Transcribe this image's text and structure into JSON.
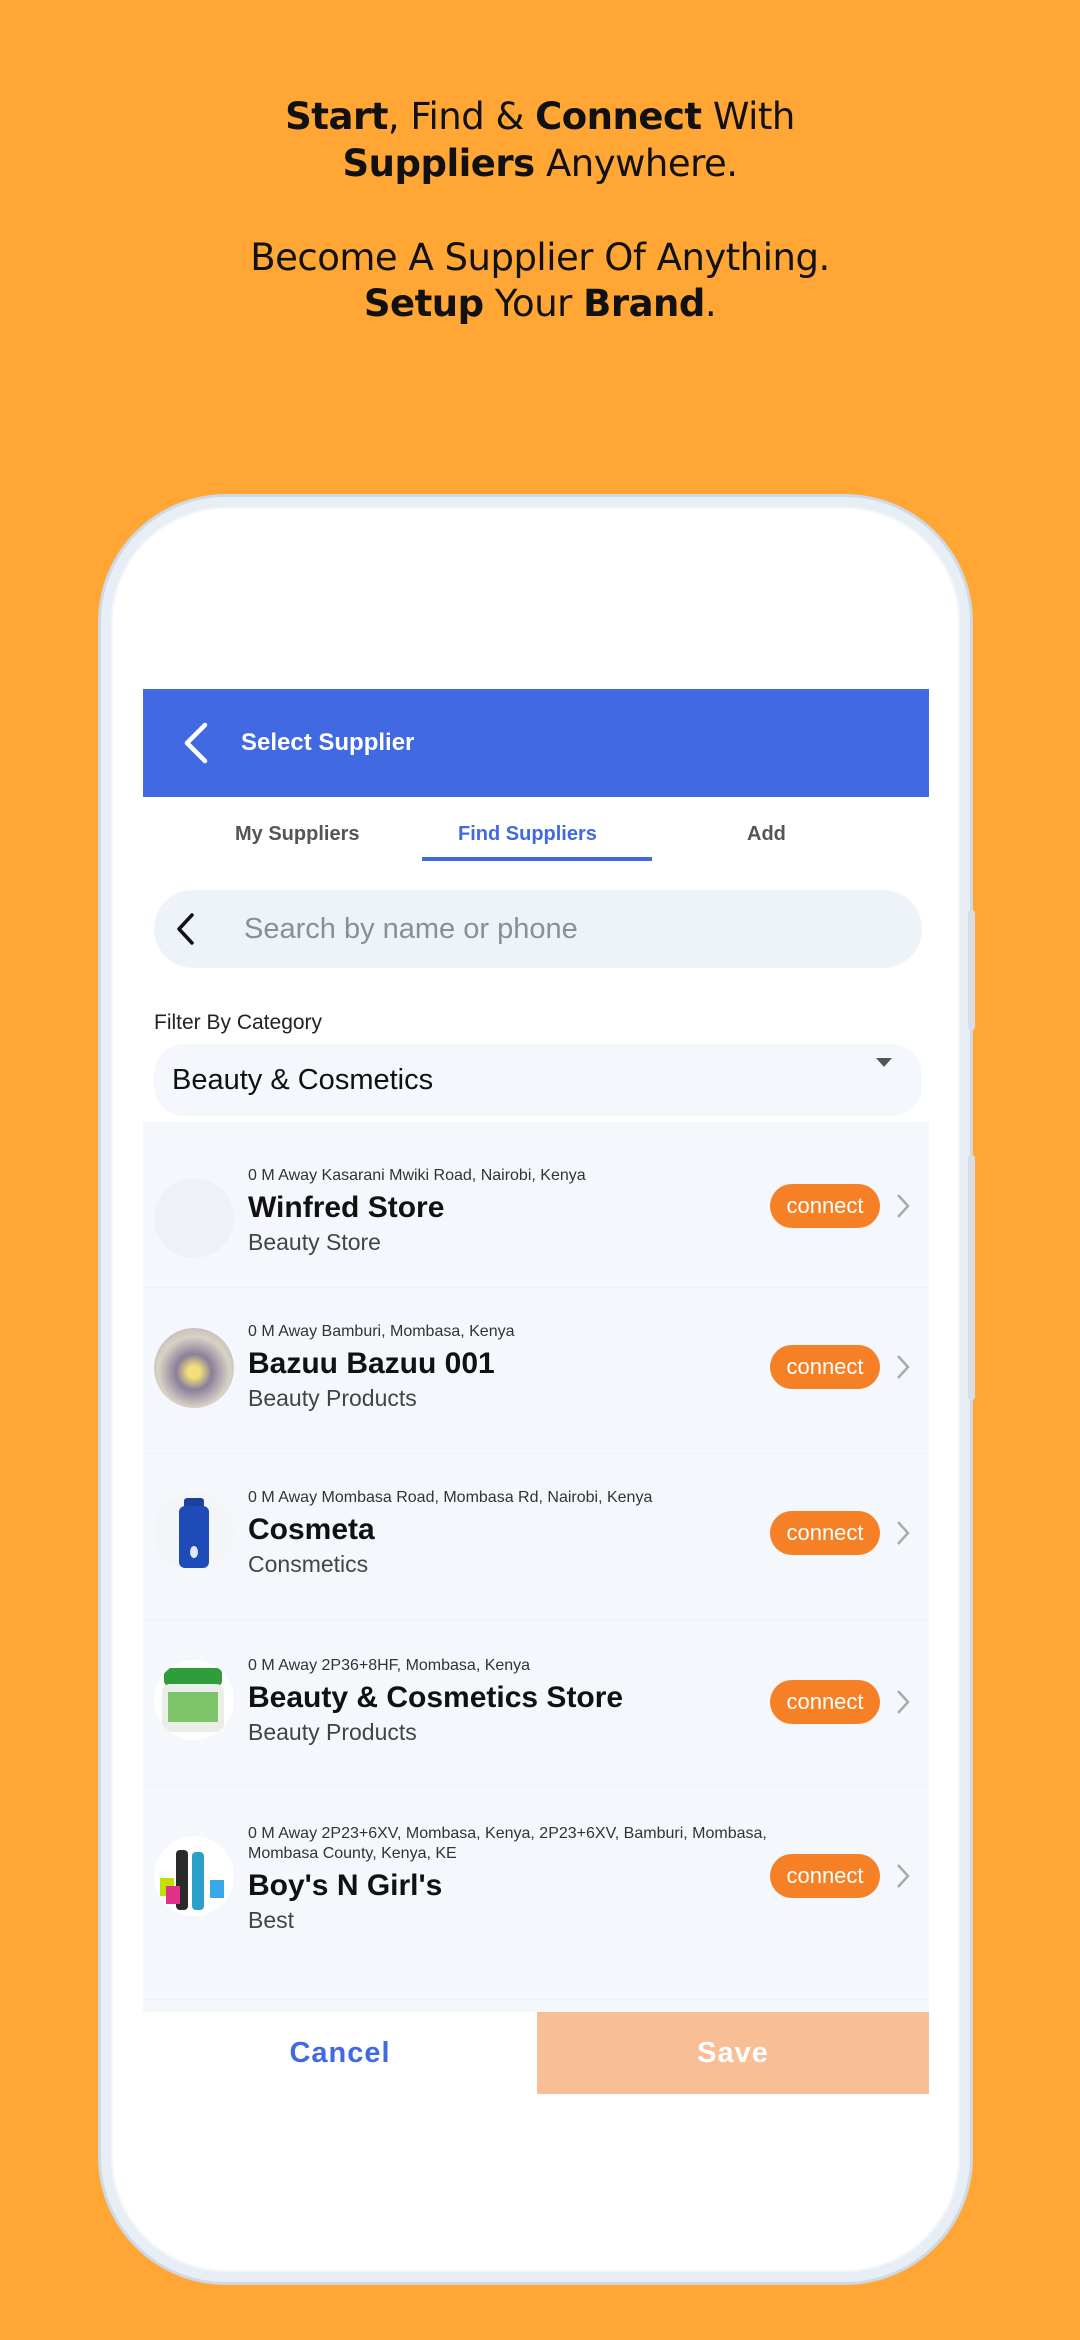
{
  "promo": {
    "line1": {
      "b1": "Start",
      "t1": ", Find & ",
      "b2": "Connect",
      "t2": " With"
    },
    "line2": {
      "b1": "Suppliers",
      "t1": " Anywhere."
    },
    "line3": "Become A Supplier Of Anything.",
    "line4": {
      "b1": "Setup",
      "t1": " Your ",
      "b2": "Brand",
      "t2": "."
    }
  },
  "appbar": {
    "title": "Select Supplier"
  },
  "tabs": [
    {
      "label": "My Suppliers"
    },
    {
      "label": "Find Suppliers",
      "active": true
    },
    {
      "label": "Add"
    }
  ],
  "search": {
    "placeholder": "Search by name or phone",
    "value": ""
  },
  "filter": {
    "label": "Filter By Category",
    "selected": "Beauty & Cosmetics"
  },
  "suppliers": [
    {
      "address": "0 M Away Kasarani Mwiki Road, Nairobi, Kenya",
      "name": "Winfred Store",
      "category": "Beauty Store",
      "action": "connect",
      "avatar": "blank"
    },
    {
      "address": "0 M Away Bamburi, Mombasa, Kenya",
      "name": "Bazuu Bazuu 001",
      "category": "Beauty Products",
      "action": "connect",
      "avatar": "photo"
    },
    {
      "address": "0 M Away Mombasa Road, Mombasa Rd, Nairobi, Kenya",
      "name": "Cosmeta",
      "category": "Consmetics",
      "action": "connect",
      "avatar": "lotion-bottle"
    },
    {
      "address": "0 M Away 2P36+8HF, Mombasa, Kenya",
      "name": "Beauty & Cosmetics Store",
      "category": "Beauty Products",
      "action": "connect",
      "avatar": "cream-jar"
    },
    {
      "address": "0 M Away 2P23+6XV, Mombasa, Kenya, 2P23+6XV, Bamburi, Mombasa, Mombasa County, Kenya, KE",
      "name": "Boy's N Girl's",
      "category": "Best",
      "action": "connect",
      "avatar": "shoppers"
    }
  ],
  "footer": {
    "cancel": "Cancel",
    "save": "Save"
  },
  "colors": {
    "background": "#FFA634",
    "primary": "#4169E1",
    "connect": "#F58025",
    "save": "#F8BF96"
  }
}
